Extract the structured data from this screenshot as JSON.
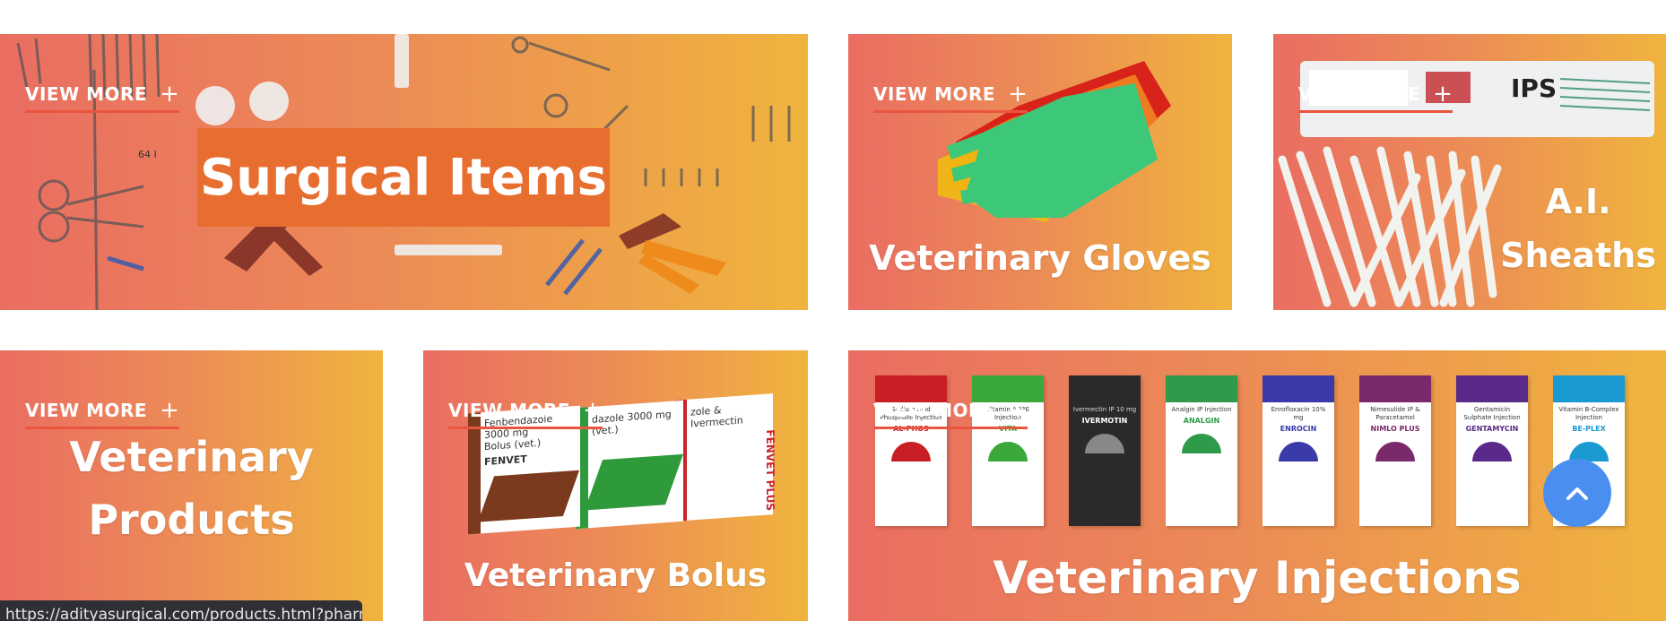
{
  "tiles": [
    {
      "id": "surgical-items",
      "view_more": "VIEW MORE",
      "title": "Surgical Items",
      "extra_text": "64 I"
    },
    {
      "id": "veterinary-gloves",
      "view_more": "VIEW MORE",
      "title": "Veterinary Gloves"
    },
    {
      "id": "ai-sheaths",
      "view_more": "VIEW MORE",
      "title_line1": "A.I.",
      "title_line2": "Sheaths",
      "pack_label": "IPS"
    },
    {
      "id": "veterinary-products",
      "view_more": "VIEW MORE",
      "title_line1": "Veterinary",
      "title_line2": "Products"
    },
    {
      "id": "veterinary-bolus",
      "view_more": "VIEW MORE",
      "title": "Veterinary Bolus",
      "boxes": [
        {
          "line1": "Fenbendazole 3000 mg",
          "line2": "Bolus (vet.)",
          "brand": "FENVET",
          "color": "#7b3a1e"
        },
        {
          "line1": "dazole 3000 mg",
          "line2": "(vet.)",
          "brand": "",
          "color": "#2f9a3c"
        },
        {
          "line1": "zole & Ivermectin",
          "line2": "",
          "brand": "FENVET PLUS",
          "color": "#c9242b"
        }
      ]
    },
    {
      "id": "veterinary-injections",
      "view_more": "VIEW MORE",
      "title": "Veterinary Injections",
      "vials": [
        {
          "label": "Sodium Acid Phosphate Injection",
          "name": "AL-PHOS",
          "color": "#c81e24"
        },
        {
          "label": "Vitamin AD3E Injection",
          "name": "VITA",
          "color": "#3aa83a"
        },
        {
          "label": "Ivermectin IP 10 mg",
          "name": "IVERMOTIN",
          "color": "#2a2a2a"
        },
        {
          "label": "Analgin IP Injection",
          "name": "ANALGIN",
          "color": "#2f9a4a"
        },
        {
          "label": "Enrofloxacin 10% mg",
          "name": "ENROCIN",
          "color": "#3a3aa8"
        },
        {
          "label": "Nimesulide IP & Paracetamol",
          "name": "NIMLO PLUS",
          "color": "#7a2a6a"
        },
        {
          "label": "Gentamicin Sulphate Injection",
          "name": "GENTAMYCIN",
          "color": "#5a2a8a"
        },
        {
          "label": "Vitamin B-Complex Injection",
          "name": "BE-PLEX",
          "color": "#1a9ad0"
        }
      ]
    }
  ],
  "status_bar": {
    "url": "https://adityasurgical.com/products.html?pharmacy"
  },
  "back_to_top": {
    "icon": "chevron-up-icon"
  },
  "colors": {
    "tile_gradient_start": "#ea6d62",
    "tile_gradient_end": "#f0b43e",
    "accent_underline": "#e9553f",
    "back_to_top": "#4a8ff0",
    "status_bar": "#2e3036"
  }
}
